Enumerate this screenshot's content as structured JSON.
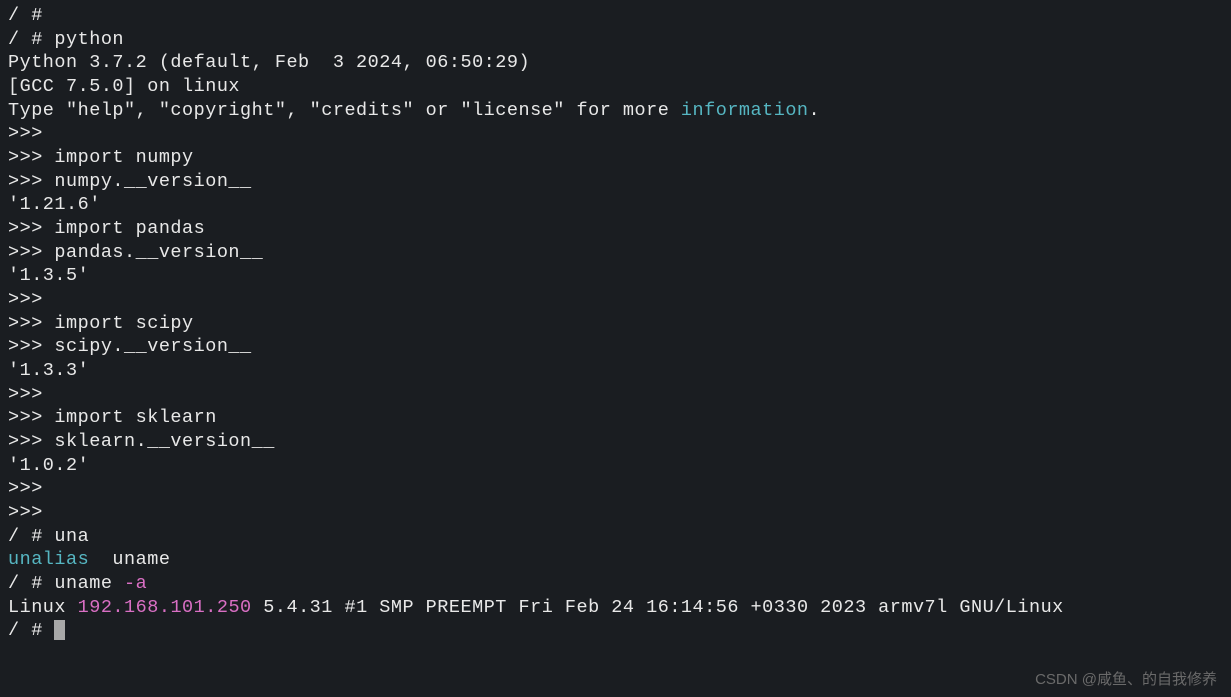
{
  "terminal": {
    "lines": [
      {
        "segs": [
          {
            "t": "/ #"
          }
        ]
      },
      {
        "segs": [
          {
            "t": "/ # python"
          }
        ]
      },
      {
        "segs": [
          {
            "t": "Python 3.7.2 (default, Feb  3 2024, 06:50:29)"
          }
        ]
      },
      {
        "segs": [
          {
            "t": "[GCC 7.5.0] on linux"
          }
        ]
      },
      {
        "segs": [
          {
            "t": "Type \"help\", \"copyright\", \"credits\" or \"license\" for more "
          },
          {
            "t": "information",
            "c": "cyan"
          },
          {
            "t": "."
          }
        ]
      },
      {
        "segs": [
          {
            "t": ">>>"
          }
        ]
      },
      {
        "segs": [
          {
            "t": ">>> import numpy"
          }
        ]
      },
      {
        "segs": [
          {
            "t": ">>> numpy.__version__"
          }
        ]
      },
      {
        "segs": [
          {
            "t": "'1.21.6'"
          }
        ]
      },
      {
        "segs": [
          {
            "t": ">>> import pandas"
          }
        ]
      },
      {
        "segs": [
          {
            "t": ">>> pandas.__version__"
          }
        ]
      },
      {
        "segs": [
          {
            "t": "'1.3.5'"
          }
        ]
      },
      {
        "segs": [
          {
            "t": ">>>"
          }
        ]
      },
      {
        "segs": [
          {
            "t": ">>> import scipy"
          }
        ]
      },
      {
        "segs": [
          {
            "t": ">>> scipy.__version__"
          }
        ]
      },
      {
        "segs": [
          {
            "t": "'1.3.3'"
          }
        ]
      },
      {
        "segs": [
          {
            "t": ">>>"
          }
        ]
      },
      {
        "segs": [
          {
            "t": ">>> import sklearn"
          }
        ]
      },
      {
        "segs": [
          {
            "t": ">>> sklearn.__version__"
          }
        ]
      },
      {
        "segs": [
          {
            "t": "'1.0.2'"
          }
        ]
      },
      {
        "segs": [
          {
            "t": ">>>"
          }
        ]
      },
      {
        "segs": [
          {
            "t": ">>>"
          }
        ]
      },
      {
        "segs": [
          {
            "t": "/ # una"
          }
        ]
      },
      {
        "segs": [
          {
            "t": "unalias",
            "c": "cyan"
          },
          {
            "t": "  uname"
          }
        ]
      },
      {
        "segs": [
          {
            "t": "/ # uname "
          },
          {
            "t": "-a",
            "c": "magenta"
          }
        ]
      },
      {
        "segs": [
          {
            "t": "Linux "
          },
          {
            "t": "192.168.101.250",
            "c": "magenta"
          },
          {
            "t": " 5.4.31 #1 SMP PREEMPT Fri Feb 24 16:14:56 +0330 2023 armv7l GNU/Linux"
          }
        ]
      },
      {
        "segs": [
          {
            "t": "/ # "
          }
        ],
        "cursor": true
      }
    ]
  },
  "watermark": "CSDN @咸鱼、的自我修养"
}
